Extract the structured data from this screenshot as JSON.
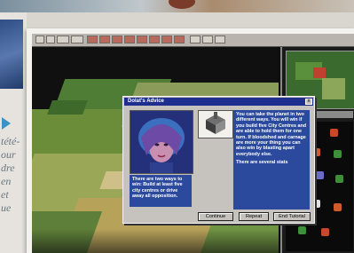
{
  "magazine": {
    "side_text": [
      "tété-",
      "our",
      "dre",
      "en",
      "et",
      "ue"
    ]
  },
  "game": {
    "dialog": {
      "title": "Dolat's Advice",
      "close_label": "x",
      "left_text": "There are two ways to win: Build at least five city centres or drive away all opposition.",
      "right_text_1": "You can take the planet in two different ways. You will win if you build five City Centres and are able to hold them for one turn. If bloodshed and carnage are more your thing you can also win by blasting apart everybody else.",
      "right_text_2": "There are several stats",
      "buttons": {
        "continue": "Continue",
        "repeat": "Repeat",
        "end_tutorial": "End Tutorial"
      }
    }
  },
  "colors": {
    "dialog_blue": "#2b4a9e",
    "titlebar": "#1e2f8f",
    "arrow": "#3a91c4"
  }
}
